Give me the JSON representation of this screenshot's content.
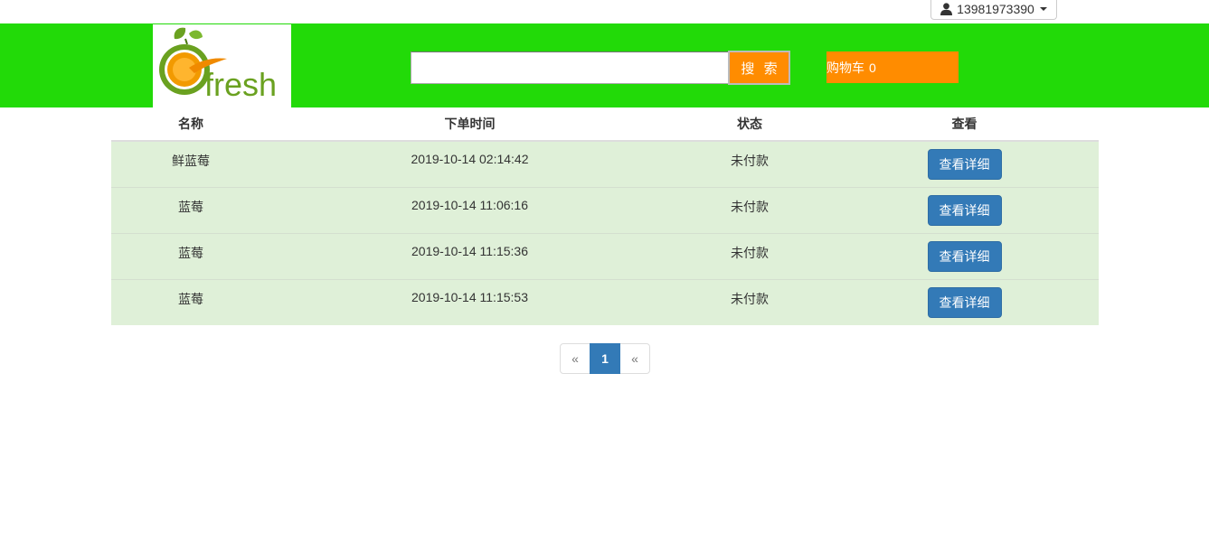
{
  "user_menu": {
    "phone": "13981973390",
    "icon": "user-icon"
  },
  "header": {
    "logo_text": "fresh",
    "search": {
      "value": "",
      "placeholder": "",
      "button_label": "搜 索"
    },
    "cart": {
      "label": "购物车",
      "count": "0"
    },
    "colors": {
      "header_bg": "#22da08",
      "accent_orange": "#ff8c00"
    }
  },
  "orders_table": {
    "columns": [
      "名称",
      "下单时间",
      "状态",
      "查看"
    ],
    "rows": [
      {
        "name": "鲜蓝莓",
        "time": "2019-10-14 02:14:42",
        "status": "未付款",
        "action": "查看详细"
      },
      {
        "name": "蓝莓",
        "time": "2019-10-14 11:06:16",
        "status": "未付款",
        "action": "查看详细"
      },
      {
        "name": "蓝莓",
        "time": "2019-10-14 11:15:36",
        "status": "未付款",
        "action": "查看详细"
      },
      {
        "name": "蓝莓",
        "time": "2019-10-14 11:15:53",
        "status": "未付款",
        "action": "查看详细"
      }
    ],
    "colors": {
      "row_bg": "#dff0d8",
      "button_bg": "#337ab7"
    }
  },
  "pagination": {
    "prev": "«",
    "current": "1",
    "next": "«"
  }
}
